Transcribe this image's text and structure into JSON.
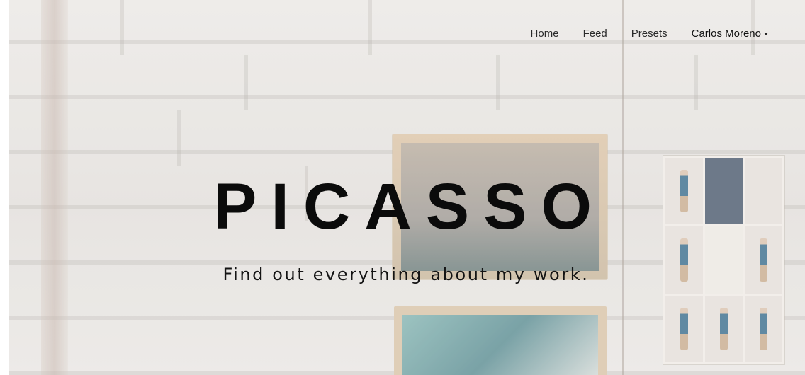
{
  "nav": {
    "items": [
      "Home",
      "Feed",
      "Presets"
    ],
    "user_menu": "Carlos Moreno"
  },
  "hero": {
    "title": "PICASSO",
    "tagline": "Find out everything about my work."
  }
}
